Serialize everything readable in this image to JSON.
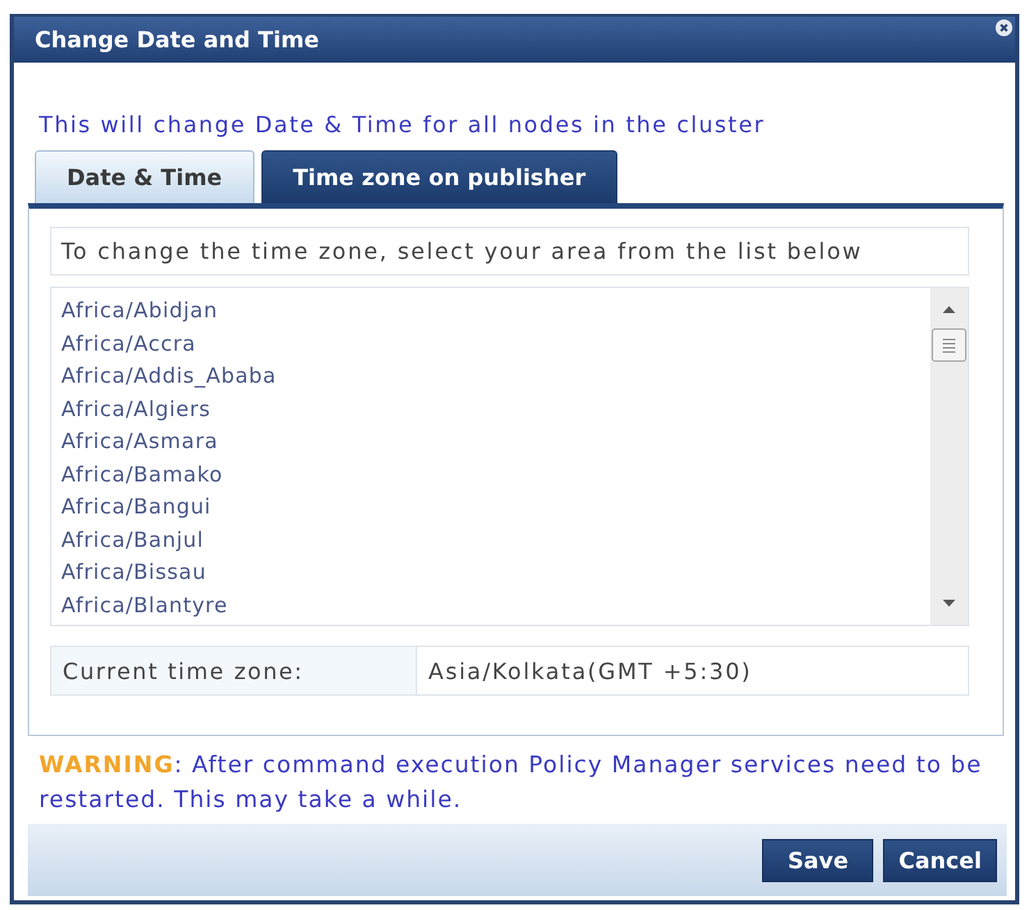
{
  "window": {
    "title": "Change Date and Time"
  },
  "info": "This will change Date & Time for all nodes in the cluster",
  "tabs": [
    {
      "label": "Date & Time",
      "selected": false
    },
    {
      "label": "Time zone on publisher",
      "selected": true
    }
  ],
  "instruction": "To change the time zone, select your area from the list below",
  "timezone_list": {
    "items": [
      {
        "label": "Africa/Abidjan",
        "selected": false
      },
      {
        "label": "Africa/Accra",
        "selected": false
      },
      {
        "label": "Africa/Addis_Ababa",
        "selected": false
      },
      {
        "label": "Africa/Algiers",
        "selected": false
      },
      {
        "label": "Africa/Asmara",
        "selected": false
      },
      {
        "label": "Africa/Bamako",
        "selected": false
      },
      {
        "label": "Africa/Bangui",
        "selected": false
      },
      {
        "label": "Africa/Banjul",
        "selected": false
      },
      {
        "label": "Africa/Bissau",
        "selected": false
      },
      {
        "label": "Africa/Blantyre",
        "selected": false
      }
    ]
  },
  "current_time_zone": {
    "label": "Current time zone:",
    "value": "Asia/Kolkata(GMT +5:30)"
  },
  "warning": "**WARNING**: After command execution Policy Manager services need to be restarted. This may take a while.",
  "buttons": [
    "Save",
    "Cancel"
  ]
}
